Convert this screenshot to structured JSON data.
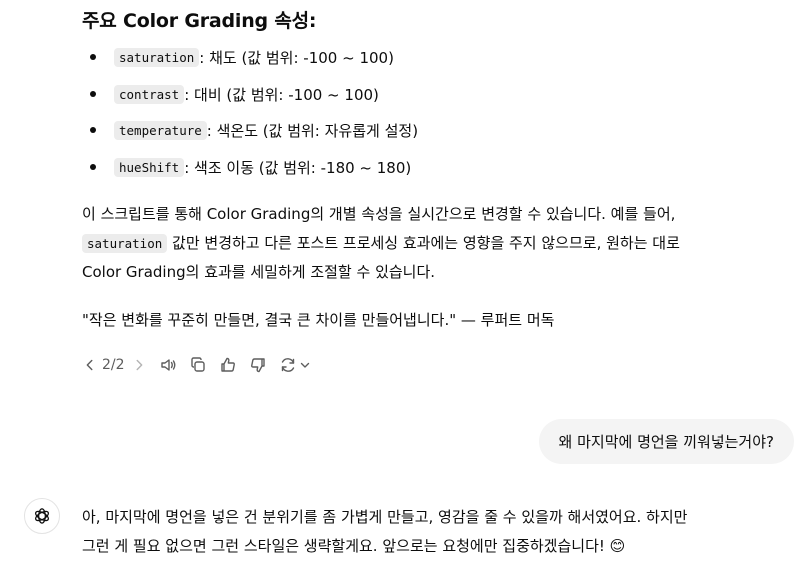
{
  "heading": "주요 Color Grading 속성:",
  "properties": [
    {
      "code": "saturation",
      "desc": ": 채도 (값 범위: -100 ~ 100)"
    },
    {
      "code": "contrast",
      "desc": ": 대비 (값 범위: -100 ~ 100)"
    },
    {
      "code": "temperature",
      "desc": ": 색온도 (값 범위: 자유롭게 설정)"
    },
    {
      "code": "hueShift",
      "desc": ": 색조 이동 (값 범위: -180 ~ 180)"
    }
  ],
  "paragraph1": {
    "line1": "이 스크립트를 통해 Color Grading의 개별 속성을 실시간으로 변경할 수 있습니다. 예를 들어,",
    "line2_code": "saturation",
    "line2_text": " 값만 변경하고 다른 포스트 프로세싱 효과에는 영향을 주지 않으므로, 원하는 대로",
    "line3": "Color Grading의 효과를 세밀하게 조절할 수 있습니다."
  },
  "quote": "\"작은 변화를 꾸준히 만들면, 결국 큰 차이를 만들어냅니다.\" — 루퍼트 머독",
  "toolbar": {
    "pager": "2/2",
    "icons": [
      "chevron-left-icon",
      "chevron-right-icon",
      "speaker-icon",
      "copy-icon",
      "thumbs-up-icon",
      "thumbs-down-icon",
      "regenerate-icon",
      "chevron-down-icon"
    ]
  },
  "user_message": "왜 마지막에 명언을 끼워넣는거야?",
  "assistant_reply": {
    "line1": "아, 마지막에 명언을 넣은 건 분위기를 좀 가볍게 만들고, 영감을 줄 수 있을까 해서였어요. 하지만",
    "line2": "그런 게 필요 없으면 그런 스타일은 생략할게요. 앞으로는 요청에만 집중하겠습니다! 😊"
  },
  "colors": {
    "text": "#0d0d0d",
    "muted": "#5d5d5d",
    "code_bg": "#ececec",
    "bubble_bg": "#f4f4f4"
  }
}
